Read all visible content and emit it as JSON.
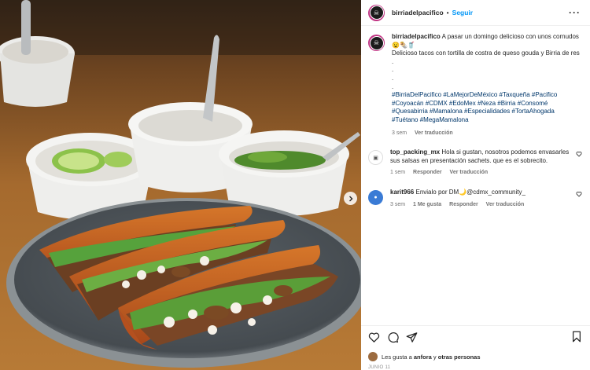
{
  "post": {
    "username": "birriadelpacifico",
    "follow_label": "Seguir",
    "separator": "•",
    "more_label": "···"
  },
  "caption": {
    "username": "birriadelpacifico",
    "line1": "A pasar un domingo delicioso con unos cornudos 😧🌯🥤",
    "line2": "Delicioso tacos con tortilla de costra de queso gouda y Birria de res",
    "dots": [
      ".",
      ".",
      ".",
      "."
    ],
    "hashtags": "#BirriaDelPacifico #LaMejorDeMéxico #Taxqueña #Pacifico #Coyoacán #CDMX #EdoMex #Neza #Birria #Consomé #Quesabirria #Mamalona #Especialidades #TortaAhogada #Tuétano #MegaMamalona",
    "time": "3 sem",
    "translate": "Ver traducción"
  },
  "comments": [
    {
      "username": "top_packing_mx",
      "text": "Hola si gustan, nosotros podemos envasarles sus salsas en presentación sachets. que es el sobrecito.",
      "time": "1 sem",
      "reply": "Responder",
      "translate": "Ver traducción",
      "likes": "",
      "avatar_color": "#ffffff"
    },
    {
      "username": "karit966",
      "text": "Envialo por DM🌙@cdmx_community_",
      "time": "3 sem",
      "reply": "Responder",
      "translate": "Ver traducción",
      "likes": "1 Me gusta",
      "avatar_color": "#3a7bd5"
    }
  ],
  "actions": {
    "likes_prefix": "Les gusta a ",
    "likes_user": "anfora",
    "likes_connector": " y ",
    "likes_others": "otras personas",
    "date": "JUNIO 11"
  },
  "icons": {
    "next": "chevron-right-icon",
    "like": "heart-icon",
    "comment": "comment-icon",
    "share": "paper-plane-icon",
    "save": "bookmark-icon"
  },
  "colors": {
    "link": "#0095f6",
    "hashtag": "#00376b",
    "muted": "#737373",
    "avatar_ring": "#c13584"
  }
}
